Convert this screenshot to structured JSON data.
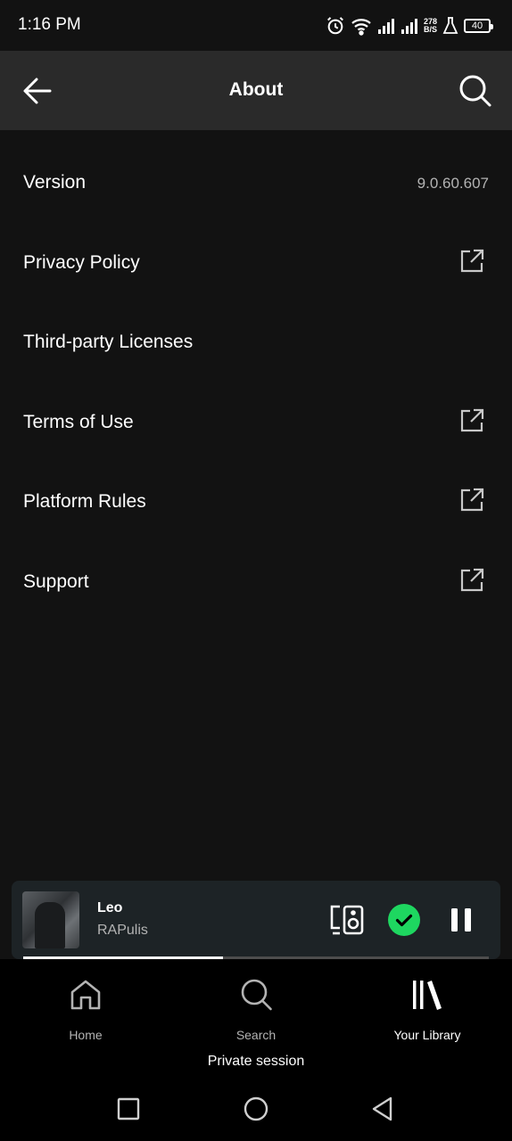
{
  "status_bar": {
    "time": "1:16 PM",
    "net_speed_value": "278",
    "net_speed_unit": "B/S",
    "battery": "40",
    "icons": [
      "alarm-icon",
      "wifi-icon",
      "signal-icon",
      "signal-icon",
      "flask-icon",
      "battery-icon"
    ]
  },
  "app_bar": {
    "title": "About",
    "back_icon": "arrow-left-icon",
    "search_icon": "search-icon"
  },
  "items": [
    {
      "label": "Version",
      "value": "9.0.60.607"
    },
    {
      "label": "Privacy Policy",
      "icon": "external-link-icon"
    },
    {
      "label": "Third-party Licenses"
    },
    {
      "label": "Terms of Use",
      "icon": "external-link-icon"
    },
    {
      "label": "Platform Rules",
      "icon": "external-link-icon"
    },
    {
      "label": "Support",
      "icon": "external-link-icon"
    }
  ],
  "now_playing": {
    "title": "Leo",
    "artist": "RAPulis",
    "progress": 0.43,
    "liked": true,
    "playing": true
  },
  "bottom_nav": {
    "tabs": [
      {
        "label": "Home",
        "icon": "home-icon",
        "active": false
      },
      {
        "label": "Search",
        "icon": "search-icon",
        "active": false
      },
      {
        "label": "Your Library",
        "icon": "library-icon",
        "active": true
      }
    ],
    "private_session": "Private session"
  },
  "colors": {
    "background": "#121212",
    "app_bar": "#2a2a2a",
    "accent_green": "#1ed760",
    "player_bg": "#1d2326",
    "secondary_text": "#b3b3b3"
  }
}
